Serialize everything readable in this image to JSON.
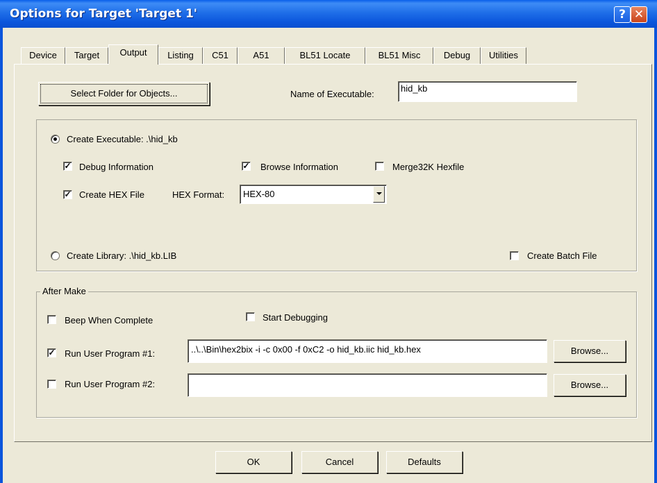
{
  "window": {
    "title": "Options for Target 'Target 1'",
    "help_glyph": "?",
    "close_glyph": "✕"
  },
  "tabs": [
    {
      "label": "Device"
    },
    {
      "label": "Target"
    },
    {
      "label": "Output"
    },
    {
      "label": "Listing"
    },
    {
      "label": "C51"
    },
    {
      "label": "A51"
    },
    {
      "label": "BL51 Locate"
    },
    {
      "label": "BL51 Misc"
    },
    {
      "label": "Debug"
    },
    {
      "label": "Utilities"
    }
  ],
  "active_tab": "Output",
  "output": {
    "select_folder_label": "Select Folder for Objects...",
    "name_exec_label": "Name of Executable:",
    "name_exec_value": "hid_kb",
    "create_exec_label": "Create Executable:  .\\hid_kb",
    "debug_info_label": "Debug Information",
    "browse_info_label": "Browse Information",
    "merge_label": "Merge32K Hexfile",
    "create_hex_label": "Create HEX File",
    "hex_format_label": "HEX Format:",
    "hex_format_value": "HEX-80",
    "create_lib_label": "Create Library:  .\\hid_kb.LIB",
    "batch_label": "Create Batch File",
    "check_glyph": "✓"
  },
  "after_make": {
    "legend": "After Make",
    "beep_label": "Beep When Complete",
    "start_debug_label": "Start Debugging",
    "run1_label": "Run User Program #1:",
    "run1_value": "..\\..\\Bin\\hex2bix -i -c 0x00 -f 0xC2 -o hid_kb.iic hid_kb.hex",
    "run2_label": "Run User Program #2:",
    "run2_value": "",
    "browse_label": "Browse..."
  },
  "footer": {
    "ok": "OK",
    "cancel": "Cancel",
    "defaults": "Defaults"
  }
}
